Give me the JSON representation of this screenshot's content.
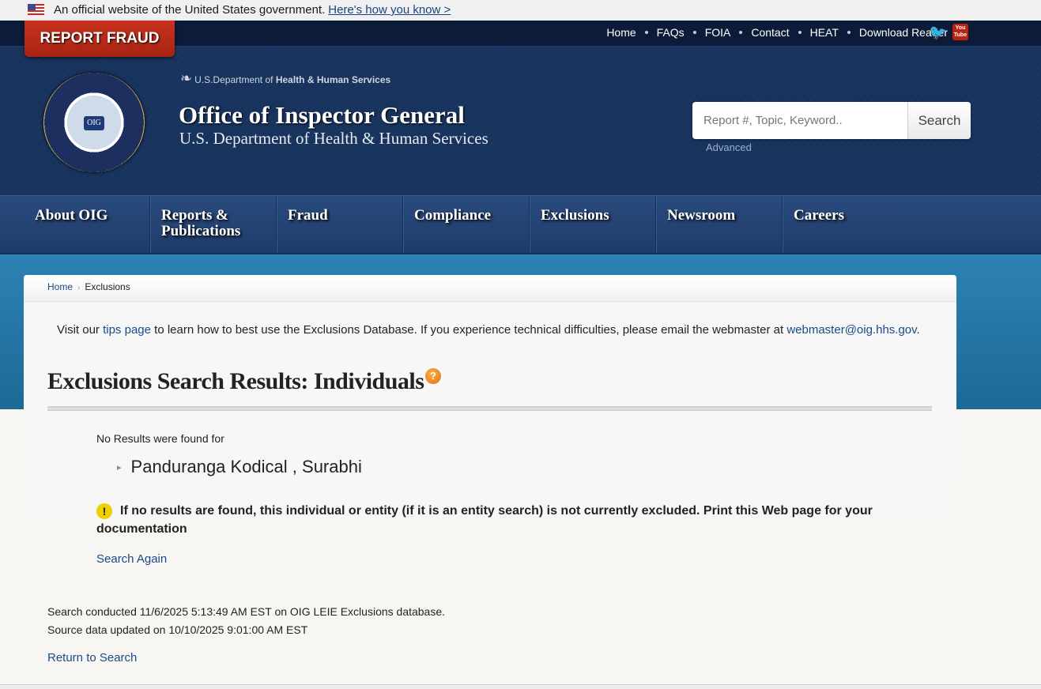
{
  "gov_banner": {
    "text": "An official website of the United States government.",
    "link": "Here's how you know >"
  },
  "report_fraud": "REPORT FRAUD",
  "top_links": [
    "Home",
    "FAQs",
    "FOIA",
    "Contact",
    "HEAT",
    "Download Reader"
  ],
  "social": {
    "twitter": "twitter-icon",
    "youtube": "You Tube"
  },
  "header": {
    "dept_prefix": "U.S.Department of ",
    "dept_bold": "Health & Human Services",
    "title": "Office of Inspector General",
    "subtitle": "U.S. Department of Health & Human Services",
    "seal_text": "OIG"
  },
  "search": {
    "placeholder": "Report #, Topic, Keyword..",
    "button": "Search",
    "advanced": "Advanced"
  },
  "nav": [
    "About OIG",
    "Reports & Publications",
    "Fraud",
    "Compliance",
    "Exclusions",
    "Newsroom",
    "Careers"
  ],
  "breadcrumb": {
    "home": "Home",
    "current": "Exclusions"
  },
  "tips": {
    "pre": "Visit our ",
    "link": "tips page",
    "mid": " to learn how to best use the Exclusions Database. If you experience technical difficulties, please email the webmaster at ",
    "email": "webmaster@oig.hhs.gov",
    "post": "."
  },
  "page_title": "Exclusions Search Results: Individuals",
  "results": {
    "no_results": "No Results were found for",
    "name": "Panduranga Kodical , Surabhi",
    "warning": "If no results are found, this individual or entity (if it is an entity search) is not currently excluded. Print this Web page for your documentation",
    "search_again": "Search Again"
  },
  "meta": {
    "conducted": "Search conducted 11/6/2025 5:13:49 AM EST on OIG LEIE Exclusions database.",
    "updated": "Source data updated on 10/10/2025 9:01:00 AM EST"
  },
  "return_link": "Return to Search"
}
